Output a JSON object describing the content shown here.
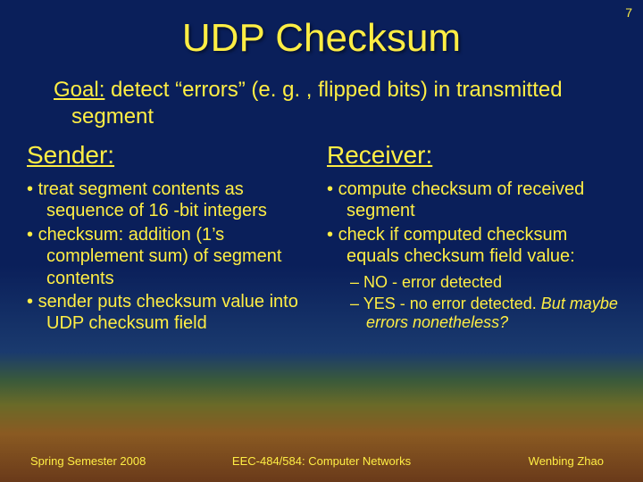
{
  "page_number": "7",
  "title": "UDP Checksum",
  "goal_label": "Goal:",
  "goal_text": " detect “errors” (e. g. , flipped bits) in transmitted segment",
  "sender": {
    "header": "Sender:",
    "bullets": [
      "treat segment contents as sequence of 16 -bit integers",
      "checksum: addition (1’s complement sum) of segment contents",
      "sender puts checksum value into UDP checksum field"
    ]
  },
  "receiver": {
    "header": "Receiver:",
    "bullets": [
      "compute checksum of received segment",
      "check if computed checksum equals checksum field value:"
    ],
    "sub_bullets": [
      {
        "pre": "NO - error detected",
        "italic": ""
      },
      {
        "pre": "YES - no error detected. ",
        "italic": "But maybe errors nonetheless?"
      }
    ]
  },
  "footer": {
    "left": "Spring Semester 2008",
    "center": "EEC-484/584: Computer Networks",
    "right": "Wenbing Zhao"
  }
}
